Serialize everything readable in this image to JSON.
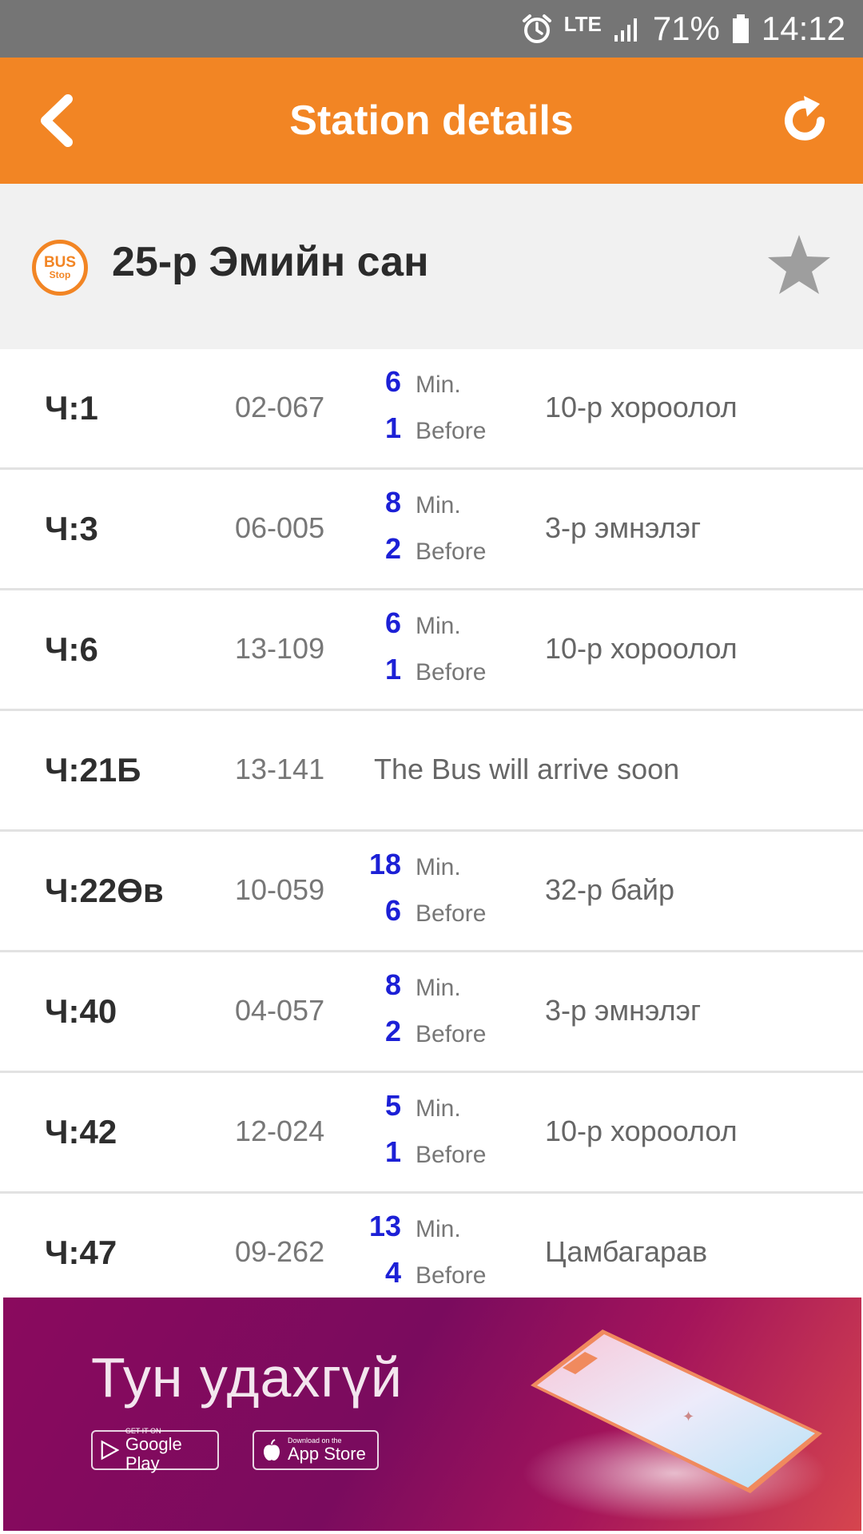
{
  "status_bar": {
    "network": "LTE",
    "battery": "71%",
    "time": "14:12"
  },
  "app_bar": {
    "title": "Station details"
  },
  "station": {
    "badge_line1": "BUS",
    "badge_line2": "Stop",
    "name": "25-р Эмийн сан"
  },
  "rows": [
    {
      "route": "Ч:1",
      "plate": "02-067",
      "min": "6",
      "min_label": "Min.",
      "before": "1",
      "before_label": "Before",
      "dest": "10-р хороолол"
    },
    {
      "route": "Ч:3",
      "plate": "06-005",
      "min": "8",
      "min_label": "Min.",
      "before": "2",
      "before_label": "Before",
      "dest": "3-р эмнэлэг"
    },
    {
      "route": "Ч:6",
      "plate": "13-109",
      "min": "6",
      "min_label": "Min.",
      "before": "1",
      "before_label": "Before",
      "dest": "10-р хороолол"
    },
    {
      "route": "Ч:21Б",
      "plate": "13-141",
      "message": "The Bus will arrive soon"
    },
    {
      "route": "Ч:22Өв",
      "plate": "10-059",
      "min": "18",
      "min_label": "Min.",
      "before": "6",
      "before_label": "Before",
      "dest": "32-р байр"
    },
    {
      "route": "Ч:40",
      "plate": "04-057",
      "min": "8",
      "min_label": "Min.",
      "before": "2",
      "before_label": "Before",
      "dest": "3-р эмнэлэг"
    },
    {
      "route": "Ч:42",
      "plate": "12-024",
      "min": "5",
      "min_label": "Min.",
      "before": "1",
      "before_label": "Before",
      "dest": "10-р хороолол"
    },
    {
      "route": "Ч:47",
      "plate": "09-262",
      "min": "13",
      "min_label": "Min.",
      "before": "4",
      "before_label": "Before",
      "dest": "Цамбагарав"
    }
  ],
  "ad": {
    "headline": "Тун удахгүй",
    "google_small": "GET IT ON",
    "google_big": "Google Play",
    "apple_small": "Download on the",
    "apple_big": "App Store"
  },
  "colors": {
    "accent": "#F28524",
    "eta_number": "#1C20D6",
    "status_bar": "#757575"
  }
}
